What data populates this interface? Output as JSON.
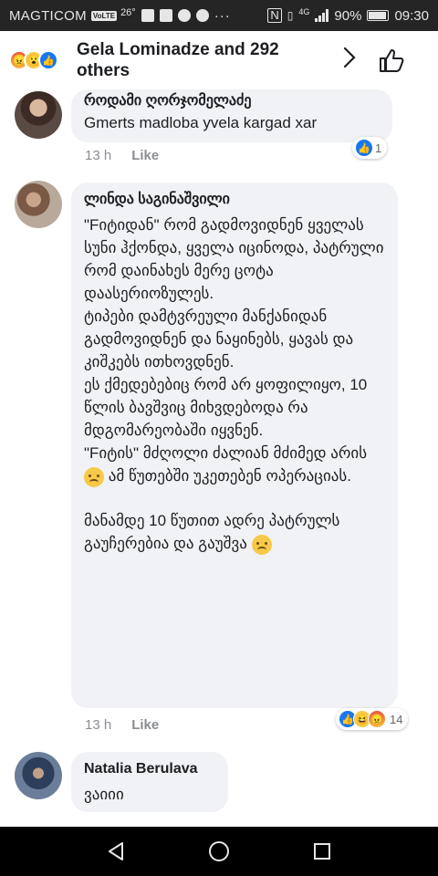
{
  "status_bar": {
    "carrier": "MAGTICOM",
    "carrier_badge": "VoLTE",
    "temperature": "26°",
    "network": "4G",
    "battery": "90%",
    "time": "09:30"
  },
  "header": {
    "reactions_summary": "Gela Lominadze and 292 others",
    "reaction_icons": [
      "angry-reaction-icon",
      "wow-reaction-icon",
      "like-reaction-icon"
    ]
  },
  "comments": [
    {
      "author": "როდამი ღორჯომელაძე",
      "text": "Gmerts madloba yvela kargad xar",
      "time": "13 h",
      "like_label": "Like",
      "reaction_count": "1"
    },
    {
      "author": "ლინდა საგინაშვილი",
      "text_before_first_emoji": "\"Fიტიდან\"  რომ გადმოვიდნენ ყველას სუნი ჰქონდა, ყველა იცინოდა, პატრული რომ დაინახეს მერე ცოტა დაასერიოზულეს.\nტიპები დამტვრეული მანქანიდან გადმოვიდნენ და ნაყინებს, ყავას და კიშკებს ითხოვდნენ.\nეს ქმედებებიც რომ არ ყოფილიყო, 10 წლის ბავშვიც მიხვდებოდა რა მდგომარეობაში იყვნენ.\n\"Fიტის\" მძღოლი ძალიან მძიმედ არის ",
      "text_after_first_emoji": " ამ წუთებში უკეთებენ ოპერაციას.",
      "text_second_paragraph": "მანამდე 10 წუთით ადრე პატრულს გაუჩერებია და გაუშვა ",
      "time": "13 h",
      "like_label": "Like",
      "reaction_count": "14"
    },
    {
      "author": "Natalia Berulava",
      "text": "ვაიიი"
    }
  ],
  "colors": {
    "accent": "#1877f2",
    "bubble": "#f0f2f5",
    "meta_text": "#8a8d91"
  }
}
